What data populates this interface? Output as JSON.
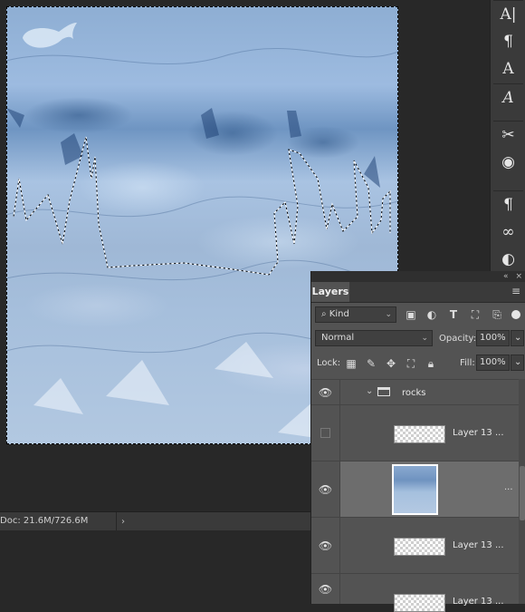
{
  "status_bar": {
    "doc_info": "Doc: 21.6M/726.6M",
    "arrow": "›"
  },
  "tools": [
    {
      "name": "character-panel-icon",
      "glyph": "A|"
    },
    {
      "name": "paragraph-styles-icon",
      "glyph": "¶"
    },
    {
      "name": "character-styles-icon",
      "glyph": "A"
    },
    {
      "name": "glyphs-icon",
      "glyph": "𝐴"
    },
    {
      "name": "tool-presets-icon",
      "glyph": "✂"
    },
    {
      "name": "swatches-icon",
      "glyph": "◉"
    },
    {
      "name": "paragraph-icon",
      "glyph": "¶"
    },
    {
      "name": "libraries-icon",
      "glyph": "∞"
    },
    {
      "name": "adjustments-icon",
      "glyph": "◐"
    }
  ],
  "layers_panel": {
    "tab_label": "Layers",
    "menu_icon": "≡",
    "header_icons": [
      "«",
      "×"
    ],
    "filter": {
      "kind_label": "Kind",
      "icons": [
        "image-filter-icon",
        "adjustment-filter-icon",
        "type-filter-icon",
        "shape-filter-icon",
        "smart-object-filter-icon",
        "filter-toggle-icon"
      ]
    },
    "blend_mode": "Normal",
    "opacity_label": "Opacity:",
    "opacity_value": "100%",
    "lock_label": "Lock:",
    "fill_label": "Fill:",
    "fill_value": "100%",
    "layers": [
      {
        "type": "group",
        "name": "rocks",
        "visible": true
      },
      {
        "type": "layer",
        "name": "Layer 13 ...",
        "visible": false,
        "thumb": "transparent"
      },
      {
        "type": "layer",
        "name": "",
        "visible": true,
        "thumb": "ice",
        "selected": true
      },
      {
        "type": "layer",
        "name": "Layer 13 ...",
        "visible": true,
        "thumb": "transparent"
      },
      {
        "type": "layer",
        "name": "Layer 13 ...",
        "visible": true,
        "thumb": "transparent"
      }
    ],
    "more_indicator": "..."
  },
  "colors": {
    "panel_bg": "#535353",
    "selected_row": "#6d6d6d",
    "canvas_bg": "#282828"
  }
}
